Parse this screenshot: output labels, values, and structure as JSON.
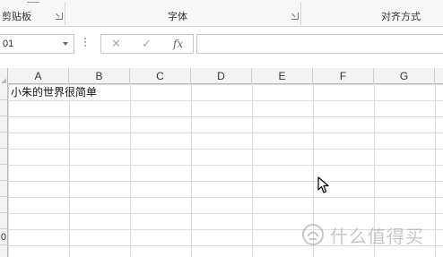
{
  "ribbon": {
    "groups": [
      {
        "label": "剪贴板"
      },
      {
        "label": "字体"
      },
      {
        "label": "对齐方式"
      }
    ]
  },
  "formula_bar": {
    "name_box_value": "01",
    "cancel_symbol": "✕",
    "enter_symbol": "✓",
    "fx_symbol": "fx",
    "formula_value": ""
  },
  "sheet": {
    "columns": [
      "A",
      "B",
      "C",
      "D",
      "E",
      "F",
      "G"
    ],
    "row_labels": [
      "",
      "",
      "",
      "",
      "",
      "",
      "",
      "",
      "",
      "0"
    ],
    "cells": [
      {
        "ref": "A1",
        "value": "小朱的世界很简单"
      }
    ]
  },
  "watermark": {
    "text": "什么值得买"
  },
  "colors": {
    "grid_line": "#dcdcdc",
    "header_bg": "#f3f3f3",
    "ribbon_bg": "#f7f7f7"
  }
}
